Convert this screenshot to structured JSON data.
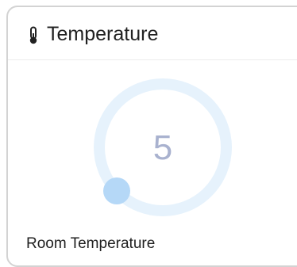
{
  "card": {
    "title": "Temperature",
    "icon": "thermometer-icon",
    "value": "5",
    "label": "Room Temperature",
    "colors": {
      "ring": "#e6f2fc",
      "handle": "#b5d8f7",
      "value_text": "#a9b2cf"
    }
  }
}
